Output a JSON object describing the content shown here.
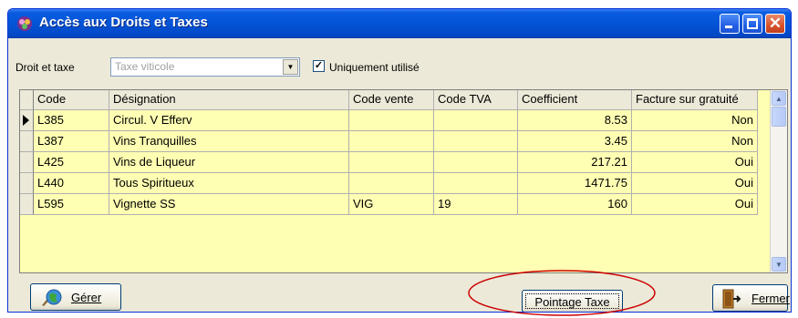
{
  "window": {
    "title": "Accès aux Droits et Taxes",
    "controls": [
      "minimize",
      "maximize",
      "close"
    ],
    "close_glyph": "✕"
  },
  "filter": {
    "label": "Droit et taxe",
    "combo_value": "Taxe viticole",
    "combo_arrow": "▼",
    "checkbox_checked": true,
    "checkbox_mark": "✓",
    "checkbox_label": "Uniquement utilisé"
  },
  "table": {
    "columns": [
      "Code",
      "Désignation",
      "Code vente",
      "Code TVA",
      "Coefficient",
      "Facture sur gratuité"
    ],
    "rows": [
      {
        "code": "L385",
        "designation": "Circul. V Efferv",
        "code_vente": "",
        "code_tva": "",
        "coefficient": "8.53",
        "facture": "Non"
      },
      {
        "code": "L387",
        "designation": "Vins Tranquilles",
        "code_vente": "",
        "code_tva": "",
        "coefficient": "3.45",
        "facture": "Non"
      },
      {
        "code": "L425",
        "designation": "Vins de Liqueur",
        "code_vente": "",
        "code_tva": "",
        "coefficient": "217.21",
        "facture": "Oui"
      },
      {
        "code": "L440",
        "designation": "Tous Spiritueux",
        "code_vente": "",
        "code_tva": "",
        "coefficient": "1471.75",
        "facture": "Oui"
      },
      {
        "code": "L595",
        "designation": "Vignette SS",
        "code_vente": "VIG",
        "code_tva": "19",
        "coefficient": "160",
        "facture": "Oui"
      }
    ],
    "current_row": 0,
    "scroll_up": "▲",
    "scroll_down": "▼"
  },
  "buttons": {
    "gerer": "Gérer",
    "pointage": "Pointage Taxe",
    "fermer": "Fermer"
  },
  "icons": {
    "title": "app-icon",
    "gerer": "globe-manage-icon",
    "fermer": "exit-door-icon"
  },
  "colors": {
    "grid_bg": "#ffffb3",
    "highlight_ellipse": "#cc0000",
    "titlebar": "#0454d6"
  }
}
